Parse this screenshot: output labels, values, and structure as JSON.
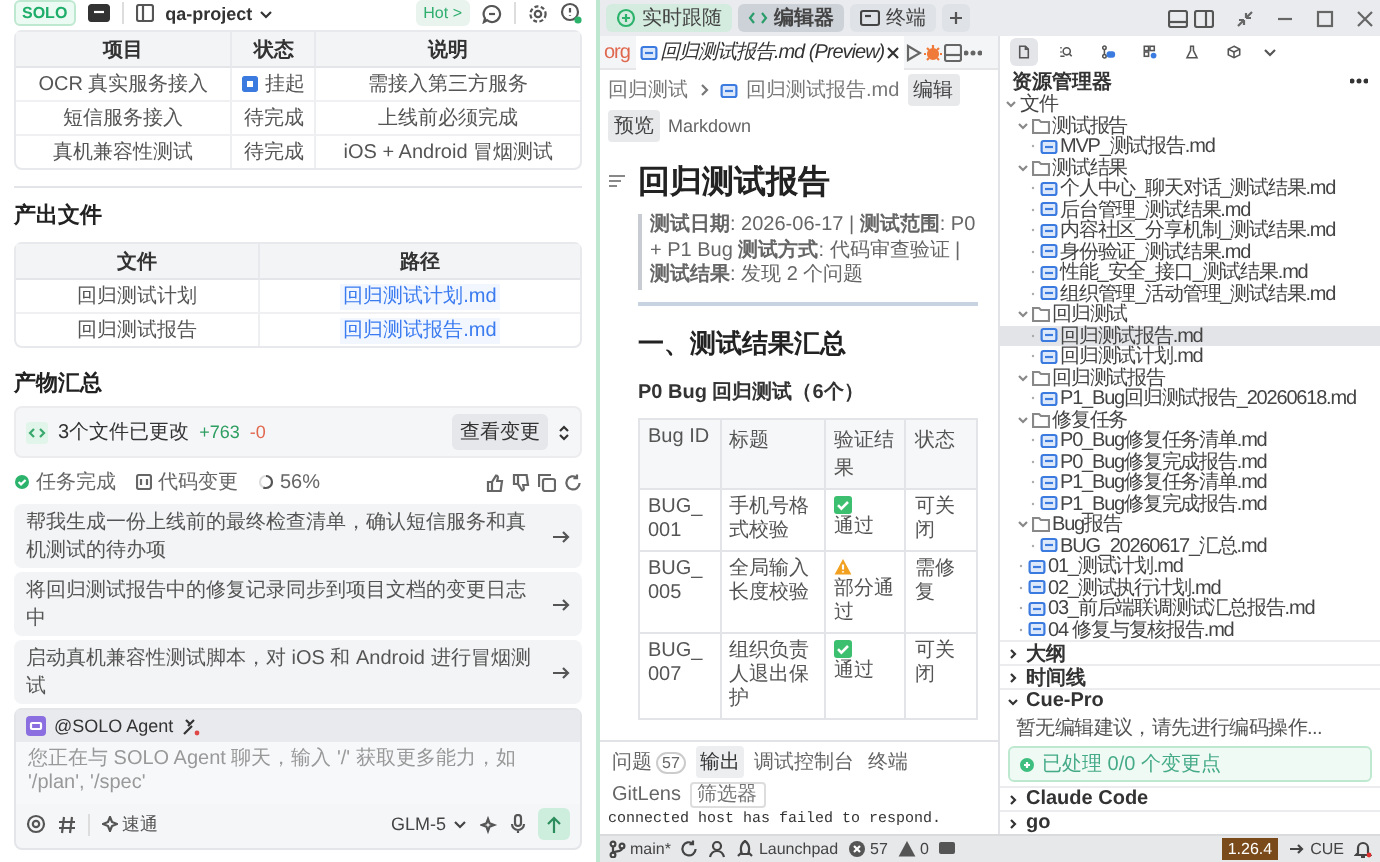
{
  "agent_panel": {
    "header": {
      "logo": "SOLO",
      "project": "qa-project",
      "hot": "Hot >"
    },
    "tasks_table": {
      "columns": [
        "项目",
        "状态",
        "说明"
      ],
      "rows": [
        {
          "item": "OCR 真实服务接入",
          "status": "挂起",
          "kind": "paused",
          "note": "需接入第三方服务"
        },
        {
          "item": "短信服务接入",
          "status": "待完成",
          "kind": "pending",
          "note": "上线前必须完成"
        },
        {
          "item": "真机兼容性测试",
          "status": "待完成",
          "kind": "pending",
          "note": "iOS + Android 冒烟测试"
        }
      ]
    },
    "outputs_heading": "产出文件",
    "outputs_table": {
      "columns": [
        "文件",
        "路径"
      ],
      "rows": [
        {
          "file": "回归测试计划",
          "path": "回归测试计划.md"
        },
        {
          "file": "回归测试报告",
          "path": "回归测试报告.md"
        }
      ]
    },
    "summary_heading": "产物汇总",
    "changes": {
      "label": "3个文件已更改",
      "added": "+763",
      "removed": "-0",
      "button": "查看变更"
    },
    "status_row": {
      "done": "任务完成",
      "code": "代码变更",
      "progress": "56%"
    },
    "suggestions": [
      "帮我生成一份上线前的最终检查清单，确认短信服务和真机测试的待办项",
      "将回归测试报告中的修复记录同步到项目文档的变更日志中",
      "启动真机兼容性测试脚本，对 iOS 和 Android 进行冒烟测试"
    ],
    "composer": {
      "agent": "@SOLO Agent",
      "placeholder": "您正在与 SOLO Agent 聊天，输入 '/' 获取更多能力，如 '/plan', '/spec'",
      "mode": "速通",
      "model": "GLM-5"
    }
  },
  "top_tabs": [
    {
      "label": "实时跟随",
      "kind": "follow",
      "selected": false
    },
    {
      "label": "编辑器",
      "kind": "code",
      "selected": true
    },
    {
      "label": "终端",
      "kind": "terminal",
      "selected": false
    }
  ],
  "editor": {
    "tabs": [
      {
        "label": "org",
        "selected": false
      },
      {
        "label": "回归测试报告.md (Preview)",
        "selected": true
      }
    ],
    "breadcrumbs": [
      "回归测试",
      "回归测试报告.md"
    ],
    "view_buttons": [
      "编辑",
      "预览"
    ],
    "language": "Markdown",
    "preview": {
      "title": "回归测试报告",
      "meta": "**测试日期**: 2026-06-17 | **测试范围**: P0 + P1 Bug **测试方式**: 代码审查验证 | **测试结果**: 发现 2 个问题",
      "section": "一、测试结果汇总",
      "subsection": "P0 Bug 回归测试（6个）",
      "table": {
        "columns": [
          "Bug ID",
          "标题",
          "验证结果",
          "状态"
        ],
        "rows": [
          {
            "id": "BUG_001",
            "title": "手机号格式校验",
            "result": "通过",
            "kind": "pass",
            "status": "可关闭"
          },
          {
            "id": "BUG_005",
            "title": "全局输入长度校验",
            "result": "部分通过",
            "kind": "warn",
            "status": "需修复"
          },
          {
            "id": "BUG_007",
            "title": "组织负责人退出保护",
            "result": "通过",
            "kind": "pass",
            "status": "可关闭"
          }
        ]
      }
    }
  },
  "panel": {
    "tabs": [
      {
        "label": "问题",
        "count": "57",
        "selected": false
      },
      {
        "label": "输出",
        "selected": true
      },
      {
        "label": "调试控制台",
        "selected": false
      },
      {
        "label": "终端",
        "selected": false
      },
      {
        "label": "GitLens",
        "selected": false
      }
    ],
    "filter_placeholder": "筛选器",
    "output": "connected host has failed to respond."
  },
  "sidebar": {
    "activity_bar": [
      {
        "kind": "files",
        "selected": true
      },
      {
        "kind": "search",
        "selected": false
      },
      {
        "kind": "git",
        "selected": false
      },
      {
        "kind": "extensions",
        "selected": false
      },
      {
        "kind": "flask",
        "selected": false
      },
      {
        "kind": "cube",
        "selected": false
      }
    ],
    "title": "资源管理器",
    "tree": [
      {
        "label": "文件",
        "kind": "folder",
        "expanded": true,
        "selected": false,
        "children": [
          {
            "label": "测试报告",
            "kind": "folder",
            "expanded": true,
            "selected": false,
            "children": [
              {
                "label": "MVP_测试报告.md",
                "kind": "file",
                "selected": false
              }
            ]
          },
          {
            "label": "测试结果",
            "kind": "folder",
            "expanded": true,
            "selected": false,
            "children": [
              {
                "label": "个人中心_聊天对话_测试结果.md",
                "kind": "file",
                "selected": false
              },
              {
                "label": "后台管理_测试结果.md",
                "kind": "file",
                "selected": false
              },
              {
                "label": "内容社区_分享机制_测试结果.md",
                "kind": "file",
                "selected": false
              },
              {
                "label": "身份验证_测试结果.md",
                "kind": "file",
                "selected": false
              },
              {
                "label": "性能_安全_接口_测试结果.md",
                "kind": "file",
                "selected": false
              },
              {
                "label": "组织管理_活动管理_测试结果.md",
                "kind": "file",
                "selected": false
              }
            ]
          },
          {
            "label": "回归测试",
            "kind": "folder",
            "expanded": true,
            "selected": false,
            "children": [
              {
                "label": "回归测试报告.md",
                "kind": "file",
                "selected": true
              },
              {
                "label": "回归测试计划.md",
                "kind": "file",
                "selected": false
              }
            ]
          },
          {
            "label": "回归测试报告",
            "kind": "folder",
            "expanded": true,
            "selected": false,
            "children": [
              {
                "label": "P1_Bug回归测试报告_20260618.md",
                "kind": "file",
                "selected": false
              }
            ]
          },
          {
            "label": "修复任务",
            "kind": "folder",
            "expanded": true,
            "selected": false,
            "children": [
              {
                "label": "P0_Bug修复任务清单.md",
                "kind": "file",
                "selected": false
              },
              {
                "label": "P0_Bug修复完成报告.md",
                "kind": "file",
                "selected": false
              },
              {
                "label": "P1_Bug修复任务清单.md",
                "kind": "file",
                "selected": false
              },
              {
                "label": "P1_Bug修复完成报告.md",
                "kind": "file",
                "selected": false
              }
            ]
          },
          {
            "label": "Bug报告",
            "kind": "folder",
            "expanded": true,
            "selected": false,
            "children": [
              {
                "label": "BUG_20260617_汇总.md",
                "kind": "file",
                "selected": false
              }
            ]
          },
          {
            "label": "01_测试计划.md",
            "kind": "file",
            "selected": false
          },
          {
            "label": "02_测试执行计划.md",
            "kind": "file",
            "selected": false
          },
          {
            "label": "03_前后端联调测试汇总报告.md",
            "kind": "file",
            "selected": false
          },
          {
            "label": "04 修复与复核报告.md",
            "kind": "file",
            "selected": false
          }
        ]
      }
    ],
    "sections": [
      {
        "label": "大纲",
        "expanded": false
      },
      {
        "label": "时间线",
        "expanded": false
      },
      {
        "label": "Cue-Pro",
        "expanded": true,
        "message": "暂无编辑建议，请先进行编码操作...",
        "processed": "已处理 0/0 个变更点"
      },
      {
        "label": "Claude Code",
        "expanded": false
      },
      {
        "label": "go",
        "expanded": false
      }
    ]
  },
  "status_bar": {
    "branch": "main*",
    "launchpad": "Launchpad",
    "errors": "57",
    "warnings": "0",
    "version": "1.26.4",
    "cue": "CUE"
  }
}
